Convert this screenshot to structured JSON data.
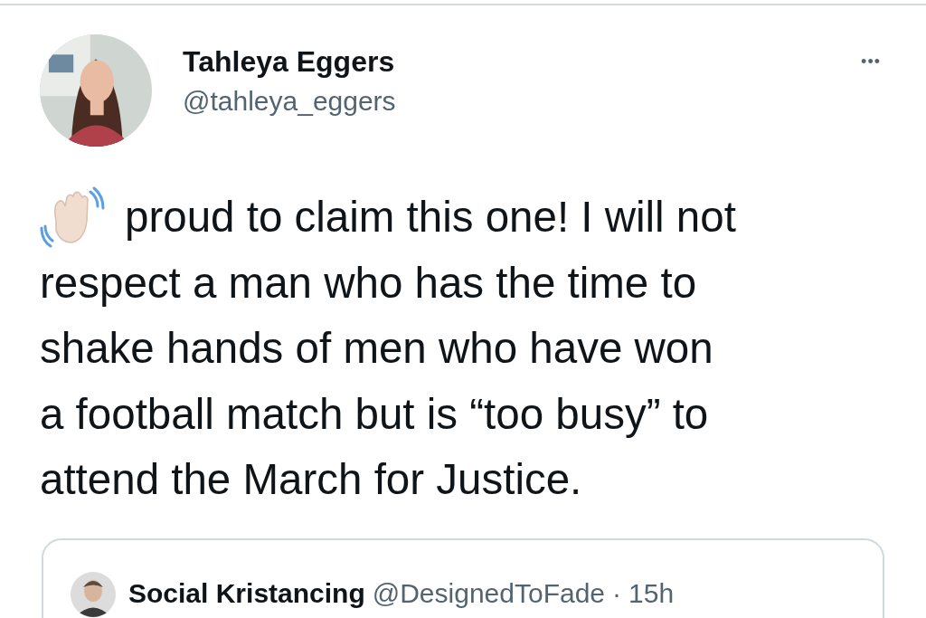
{
  "tweet": {
    "author": {
      "name": "Tahleya Eggers",
      "handle": "@tahleya_eggers"
    },
    "more": "•••",
    "text_lines": [
      "proud to claim this one! I will not",
      "respect a man who has the time to",
      "shake hands of men who have won",
      "a football match but is “too busy” to",
      "attend the March for Justice."
    ],
    "quoted": {
      "name": "Social Kristancing",
      "handle": "@DesignedToFade",
      "separator": "·",
      "time": "15h"
    }
  }
}
